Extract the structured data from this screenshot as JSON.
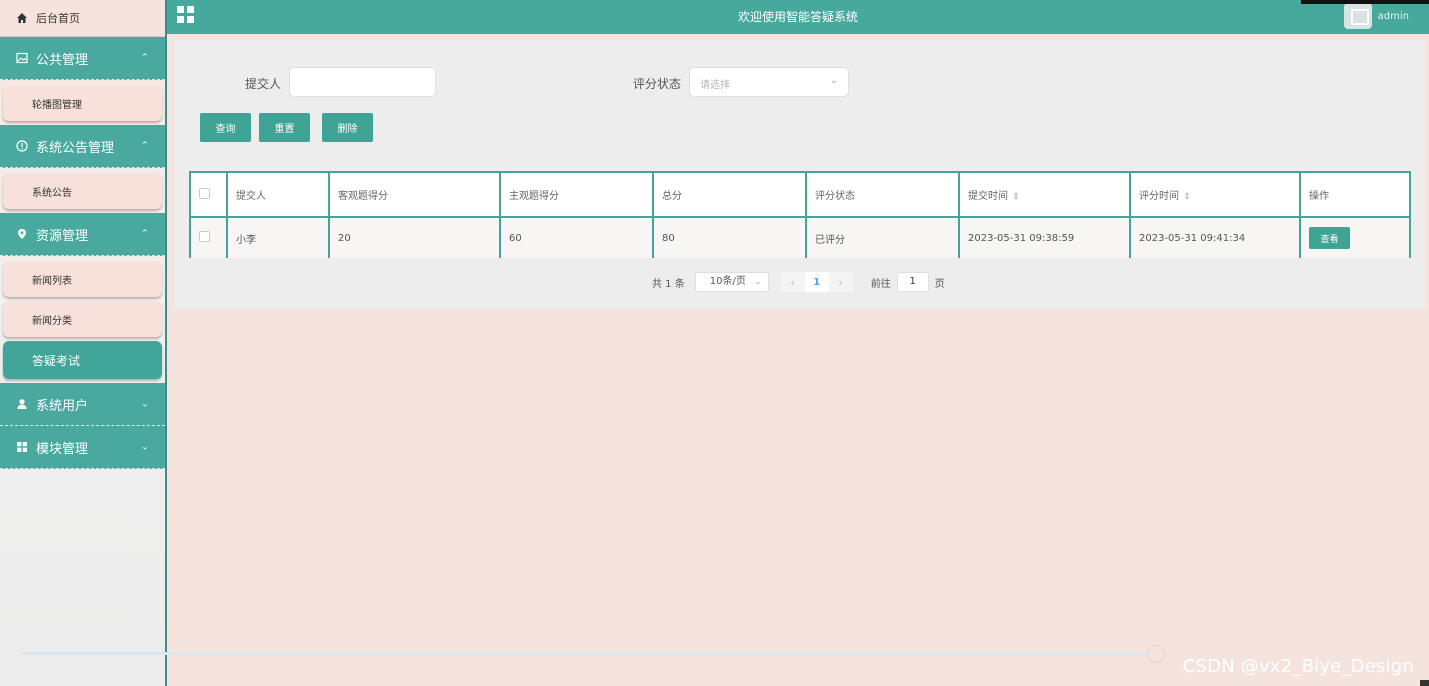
{
  "sidebar": {
    "home_label": "后台首页",
    "groups": [
      {
        "label": "公共管理",
        "expanded": true,
        "items": [
          {
            "label": "轮播图管理",
            "active": false
          }
        ]
      },
      {
        "label": "系统公告管理",
        "expanded": true,
        "items": [
          {
            "label": "系统公告",
            "active": false
          }
        ]
      },
      {
        "label": "资源管理",
        "expanded": true,
        "items": [
          {
            "label": "新闻列表",
            "active": false
          },
          {
            "label": "新闻分类",
            "active": false
          },
          {
            "label": "答疑考试",
            "active": true
          }
        ]
      },
      {
        "label": "系统用户",
        "expanded": false,
        "items": []
      },
      {
        "label": "模块管理",
        "expanded": false,
        "items": []
      }
    ]
  },
  "header": {
    "title": "欢迎使用智能答疑系统",
    "username": "admin"
  },
  "filters": {
    "submitter_label": "提交人",
    "submitter_value": "",
    "status_label": "评分状态",
    "status_placeholder": "请选择"
  },
  "buttons": {
    "query": "查询",
    "reset": "重置",
    "delete": "删除"
  },
  "table": {
    "columns": [
      "提交人",
      "客观题得分",
      "主观题得分",
      "总分",
      "评分状态",
      "提交时间",
      "评分时间",
      "操作"
    ],
    "rows": [
      {
        "submitter": "小李",
        "objective_score": "20",
        "subjective_score": "60",
        "total": "80",
        "status": "已评分",
        "submit_time": "2023-05-31 09:38:59",
        "grade_time": "2023-05-31 09:41:34",
        "action": "查看"
      }
    ]
  },
  "pagination": {
    "total_text": "共 1 条",
    "page_size": "10条/页",
    "current_page": "1",
    "goto_label": "前往",
    "goto_value": "1",
    "page_unit": "页"
  },
  "watermark": "CSDN @vx2_Biye_Design",
  "colors": {
    "primary": "#46a99c",
    "sidebar_active": "#3fa699",
    "page_bg": "#f5e4de"
  }
}
